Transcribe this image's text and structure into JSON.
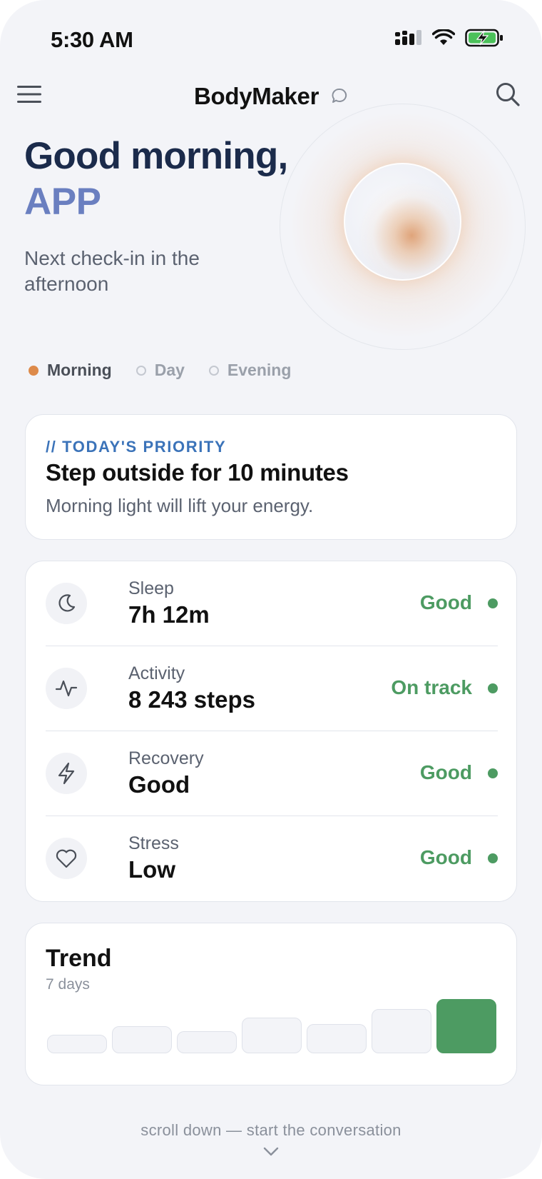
{
  "status_bar": {
    "time": "5:30 AM"
  },
  "nav": {
    "title": "BodyMaker"
  },
  "greeting": {
    "line1": "Good morning,",
    "name": "APP",
    "next_checkin": "Next check-in in the afternoon"
  },
  "segments": [
    {
      "label": "Morning",
      "active": true
    },
    {
      "label": "Day",
      "active": false
    },
    {
      "label": "Evening",
      "active": false
    }
  ],
  "priority": {
    "kicker": "// TODAY'S PRIORITY",
    "title": "Step outside for 10 minutes",
    "subtitle": "Morning light will lift your energy."
  },
  "metrics": [
    {
      "icon": "moon-icon",
      "label": "Sleep",
      "value": "7h 12m",
      "status": "Good"
    },
    {
      "icon": "activity-icon",
      "label": "Activity",
      "value": "8 243 steps",
      "status": "On track"
    },
    {
      "icon": "bolt-icon",
      "label": "Recovery",
      "value": "Good",
      "status": "Good"
    },
    {
      "icon": "heart-icon",
      "label": "Stress",
      "value": "Low",
      "status": "Good"
    }
  ],
  "trend": {
    "title": "Trend",
    "subtitle": "7 days",
    "relative_levels": [
      0.2,
      0.38,
      0.28,
      0.58,
      0.44,
      0.78,
      1.0
    ],
    "highlight_index": 6
  },
  "colors": {
    "accent_blue": "#3b73b9",
    "status_green": "#4d9b62",
    "active_orange": "#dd8a4a",
    "name_purple": "#6a7fc0"
  },
  "scroll_hint": "scroll down — start the conversation"
}
